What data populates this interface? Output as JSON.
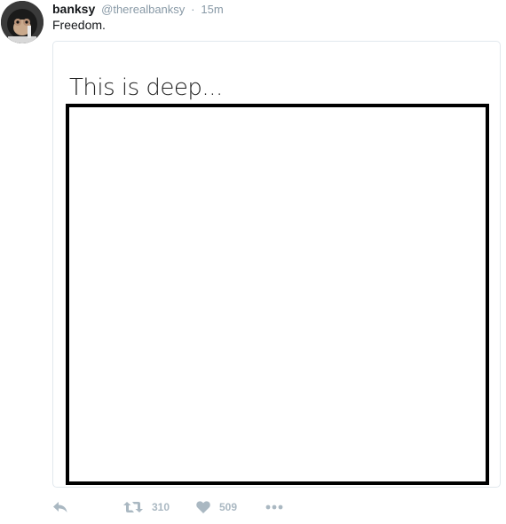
{
  "tweet": {
    "user_name": "banksy",
    "user_handle": "@therealbanksy",
    "separator": "·",
    "timestamp": "15m",
    "text": "Freedom."
  },
  "media": {
    "caption": "This is deep..."
  },
  "actions": {
    "retweet_count": "310",
    "like_count": "509"
  },
  "colors": {
    "muted": "#aab8c2",
    "handle": "#8899a6",
    "text": "#14171a",
    "card_border": "#e1e8ed"
  },
  "icons": {
    "reply": "reply-icon",
    "retweet": "retweet-icon",
    "like": "heart-icon",
    "more": "more-dots-icon"
  }
}
